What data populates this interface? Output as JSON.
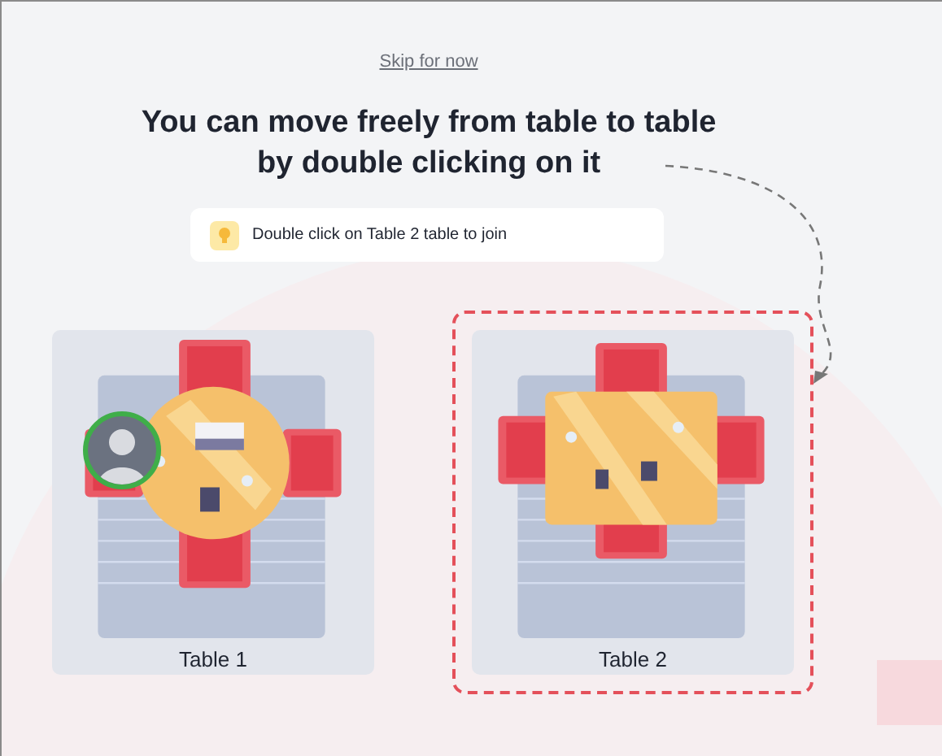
{
  "skip_link": "Skip for now",
  "heading": "You can move freely from table to table by double clicking on it",
  "hint": {
    "text": "Double click on Table 2 table to join"
  },
  "tables": [
    {
      "label": "Table 1",
      "kind": "round",
      "selected": false,
      "occupied": true
    },
    {
      "label": "Table 2",
      "kind": "square",
      "selected": true,
      "occupied": false
    }
  ]
}
